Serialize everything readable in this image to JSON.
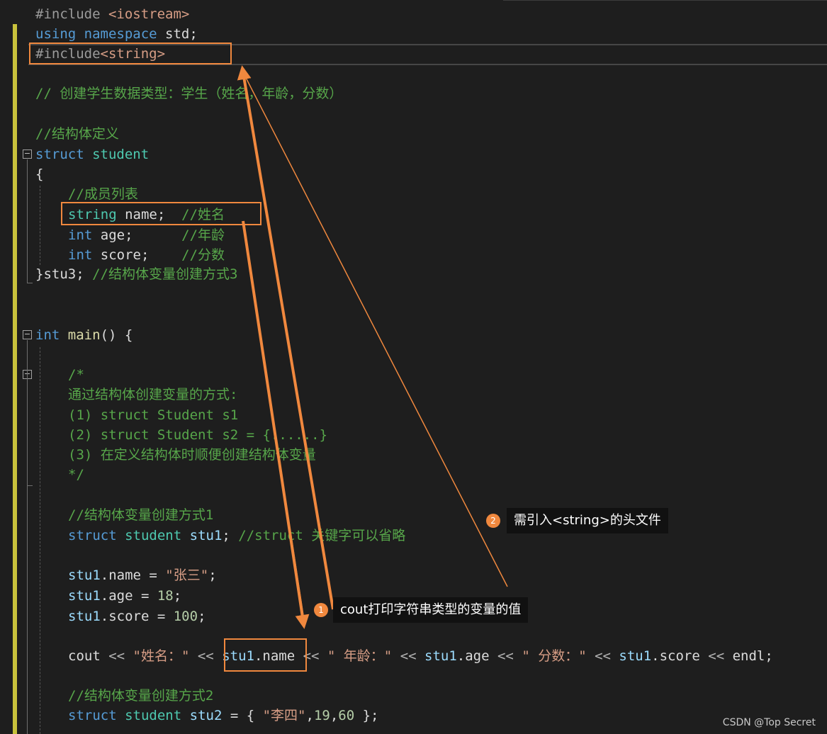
{
  "code": {
    "l1": {
      "pp": "#include ",
      "arg": "<iostream>"
    },
    "l2": {
      "kw1": "using",
      "kw2": "namespace",
      "rest": " std;"
    },
    "l3": {
      "pp": "#include",
      "arg": "<string>"
    },
    "l4": {
      "comment": "// 创建学生数据类型：学生（姓名，年龄，分数）"
    },
    "l5": {
      "comment": "//结构体定义"
    },
    "l6": {
      "kw": "struct",
      "ty": "student"
    },
    "l7": {
      "text": "{"
    },
    "l8": {
      "comment": "//成员列表"
    },
    "l9": {
      "ty": "string",
      "rest": " name;",
      "comment": "//姓名"
    },
    "l10": {
      "kw": "int",
      "rest": " age;",
      "comment": "//年龄"
    },
    "l11": {
      "kw": "int",
      "rest": " score;",
      "comment": "//分数"
    },
    "l12": {
      "text": "}stu3;",
      "comment": "//结构体变量创建方式3"
    },
    "l13": {
      "kw": "int",
      "fn": "main",
      "rest": "() {"
    },
    "c1": "/*",
    "c2": "通过结构体创建变量的方式:",
    "c3": "(1) struct Student s1",
    "c4": "(2) struct Student s2 = {......}",
    "c5": "(3) 在定义结构体时顺便创建结构体变量",
    "c6": "*/",
    "l14": {
      "comment": "//结构体变量创建方式1"
    },
    "l15": {
      "kw": "struct",
      "ty": "student",
      "var": "stu1",
      "semi": ";",
      "comment": "//struct 关键字可以省略"
    },
    "l16": {
      "var": "stu1",
      "member": ".name",
      "eq": " = ",
      "str": "\"张三\"",
      "semi": ";"
    },
    "l17": {
      "var": "stu1",
      "member": ".age",
      "eq": " = ",
      "num": "18",
      "semi": ";"
    },
    "l18": {
      "var": "stu1",
      "member": ".score",
      "eq": " = ",
      "num": "100",
      "semi": ";"
    },
    "l19": {
      "cout": "cout",
      "op": " << ",
      "s1": "\"姓名：\"",
      "v1": "stu1",
      "m1": ".name",
      "s2": "\" 年龄：\"",
      "v2": "stu1",
      "m2": ".age",
      "s3": "\" 分数：\"",
      "v3": "stu1",
      "m3": ".score",
      "end": "endl",
      "semi": ";"
    },
    "l20": {
      "comment": "//结构体变量创建方式2"
    },
    "l21": {
      "kw": "struct",
      "ty": "student",
      "var": "stu2",
      "eq": " = { ",
      "str": "\"李四\"",
      "rest": ",",
      "n1": "19",
      "comma": ",",
      "n2": "60",
      "close": " };"
    }
  },
  "annotations": [
    {
      "badge": "1",
      "text": "cout打印字符串类型的变量的值"
    },
    {
      "badge": "2",
      "text": "需引入<string>的头文件"
    }
  ],
  "watermark": "CSDN @Top Secret",
  "colors": {
    "accent": "#f0883e",
    "keyword": "#569cd6",
    "type": "#4ec9b0",
    "comment": "#57a64a",
    "string": "#d69d85"
  }
}
